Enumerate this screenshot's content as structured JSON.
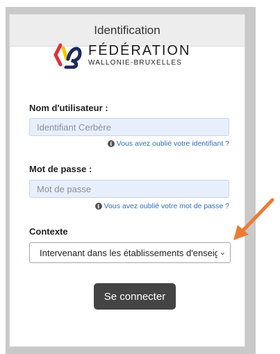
{
  "header": {
    "title": "Identification"
  },
  "logo": {
    "main": "FÉDÉRATION",
    "sub": "WALLONIE-BRUXELLES"
  },
  "username": {
    "label": "Nom d'utilisateur :",
    "placeholder": "Identifiant Cerbère",
    "help": "Vous avez oublié votre identifiant ?"
  },
  "password": {
    "label": "Mot de passe :",
    "placeholder": "Mot de passe",
    "help": "Vous avez oublié votre mot de passe ?"
  },
  "context": {
    "label": "Contexte",
    "selected": "Intervenant dans les établissements d'enseignement"
  },
  "login_button": "Se connecter",
  "colors": {
    "arrow": "#ee7a36",
    "button": "#444444",
    "link": "#2f6fbf",
    "input_bg": "#e8effc"
  }
}
